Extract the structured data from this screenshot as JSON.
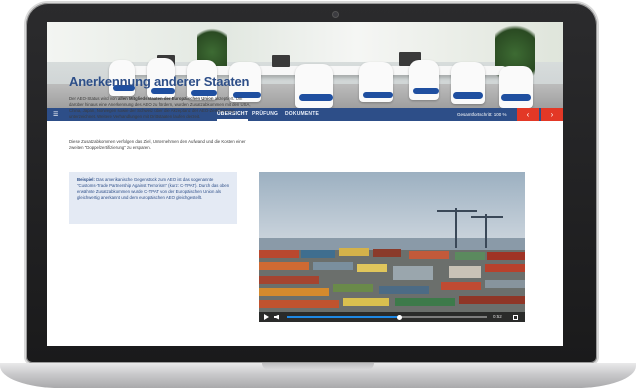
{
  "nav": {
    "menu_icon": "menu-icon",
    "tabs": [
      {
        "label": "ÜBERSICHT",
        "active": true
      },
      {
        "label": "PRÜFUNG",
        "active": false
      },
      {
        "label": "DOKUMENTE",
        "active": false
      }
    ],
    "progress_text": "Gesamtfortschritt: 100 %",
    "prev_icon": "chevron-left-icon",
    "next_icon": "chevron-right-icon",
    "accent_color": "#2d4e88",
    "button_color": "#e33826"
  },
  "content": {
    "title": "Anerkennung anderer Staaten",
    "paragraph1_pre": "Der AEO-Status wird von ",
    "paragraph1_bold": "allen Mitgliedsstaaten der Europäischen Union",
    "paragraph1_post": " akzeptiert. Um darüber hinaus eine Anerkennung des AEO zu fördern, wurden Zusatzabkommen mit den USA, China, Japan, Norwegen sowie der Schweiz über die Akzeptanz der AEO-Zertifizierung unterzeichnet. Weitere Verhandlungen mit Drittstaaten laufen derzeit.",
    "paragraph2": "Diese Zusatzabkommen verfolgen das Ziel, Unternehmen den Aufwand und die Kosten einer zweiten \"Doppelzertifizierung\" zu ersparen.",
    "example_label": "Beispiel:",
    "example_text": " Das amerikanische Gegenstück zum AEO ist das sogenannte \"Customs-Trade Partnership Against Terrorism\" (kurz: C-TPAT). Durch das oben erwähnte Zusatzabkommen wurde C-TPAT von der Europäischen Union als gleichwertig anerkannt und dem europäischen AEO gleichgestellt."
  },
  "video": {
    "play_icon": "play-icon",
    "volume_icon": "volume-icon",
    "fullscreen_icon": "fullscreen-icon",
    "progress": 0.56,
    "time": "0:52"
  }
}
